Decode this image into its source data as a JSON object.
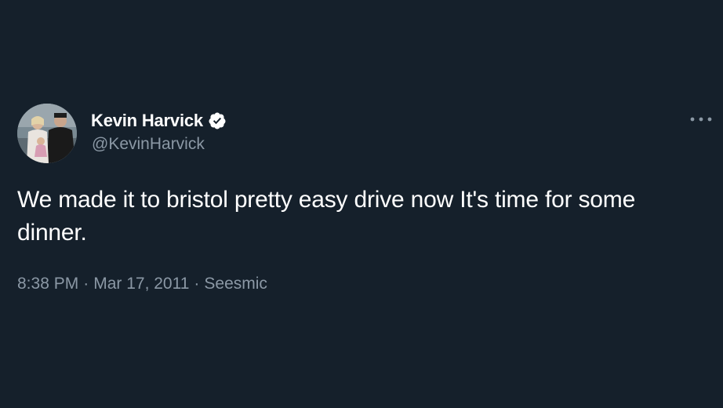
{
  "colors": {
    "background": "#15202b",
    "primary_text": "#ffffff",
    "secondary_text": "#8b98a5",
    "verified_badge": "#ffffff"
  },
  "author": {
    "display_name": "Kevin Harvick",
    "handle": "@KevinHarvick",
    "verified": true,
    "avatar_icon": "profile-photo",
    "verified_icon": "verified-badge-icon"
  },
  "more_icon": "more-horizontal-icon",
  "tweet": {
    "text": "We made it to bristol pretty easy drive now It's time for some dinner."
  },
  "meta": {
    "time": "8:38 PM",
    "separator": "·",
    "date": "Mar 17, 2011",
    "source": "Seesmic"
  }
}
